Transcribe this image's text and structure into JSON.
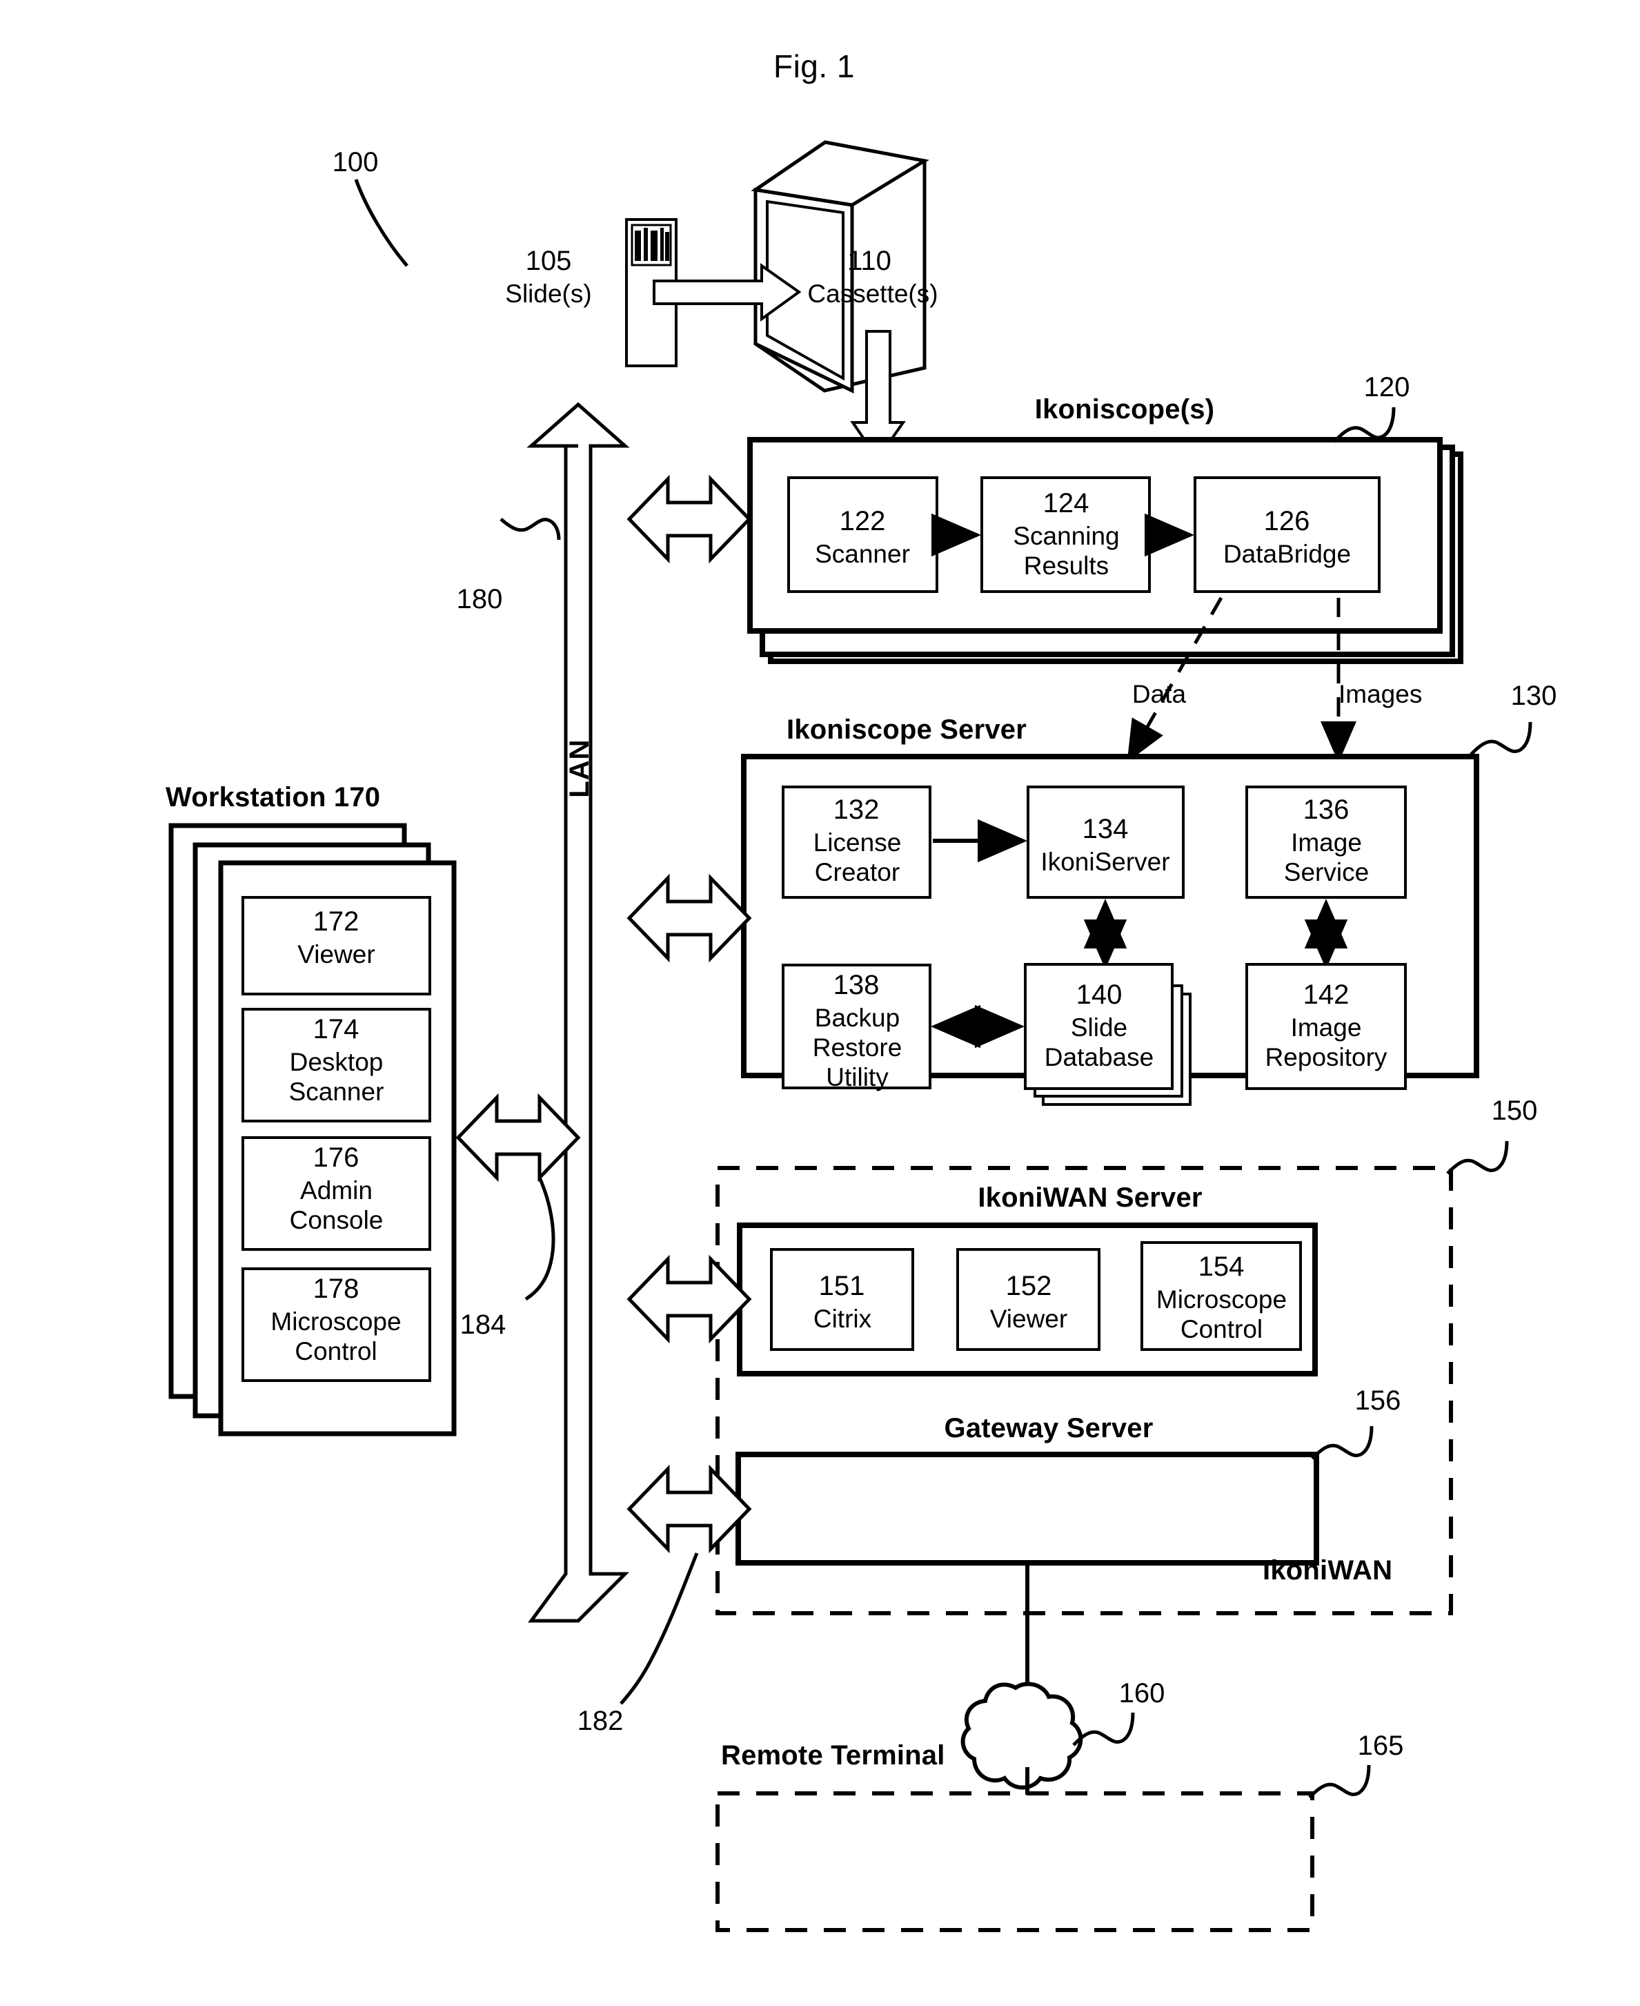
{
  "figure": {
    "title": "Fig. 1",
    "system_ref": "100"
  },
  "input_stage": {
    "slide": {
      "ref": "105",
      "label": "Slide(s)"
    },
    "cassette": {
      "ref": "110",
      "label": "Cassette(s)"
    }
  },
  "ikoniscope": {
    "ref": "120",
    "title": "Ikoniscope(s)",
    "modules": [
      {
        "ref": "122",
        "label": "Scanner"
      },
      {
        "ref": "124",
        "label": "Scanning\nResults"
      },
      {
        "ref": "126",
        "label": "DataBridge"
      }
    ]
  },
  "flow_labels": {
    "data": "Data",
    "images": "Images"
  },
  "ikoniscope_server": {
    "ref": "130",
    "title": "Ikoniscope Server",
    "modules": [
      {
        "ref": "132",
        "label": "License\nCreator"
      },
      {
        "ref": "134",
        "label": "IkoniServer"
      },
      {
        "ref": "136",
        "label": "Image\nService"
      },
      {
        "ref": "138",
        "label": "Backup\nRestore\nUtility"
      },
      {
        "ref": "140",
        "label": "Slide\nDatabase"
      },
      {
        "ref": "142",
        "label": "Image\nRepository"
      }
    ]
  },
  "ikoniwan": {
    "ref": "150",
    "zone_label": "IkoniWAN",
    "server_title": "IkoniWAN Server",
    "modules": [
      {
        "ref": "151",
        "label": "Citrix"
      },
      {
        "ref": "152",
        "label": "Viewer"
      },
      {
        "ref": "154",
        "label": "Microscope\nControl"
      }
    ],
    "gateway": {
      "ref": "156",
      "title": "Gateway Server"
    }
  },
  "workstation": {
    "title": "Workstation 170",
    "modules": [
      {
        "ref": "172",
        "label": "Viewer"
      },
      {
        "ref": "174",
        "label": "Desktop\nScanner"
      },
      {
        "ref": "176",
        "label": "Admin\nConsole"
      },
      {
        "ref": "178",
        "label": "Microscope\nControl"
      }
    ]
  },
  "network": {
    "lan_label": "LAN",
    "lan_ref": "180",
    "lan_bottom_ref": "182",
    "workstation_link_ref": "184",
    "cloud_ref": "160"
  },
  "remote": {
    "title": "Remote Terminal",
    "ref": "165"
  },
  "colors": {
    "ink": "#000000",
    "paper": "#ffffff"
  }
}
